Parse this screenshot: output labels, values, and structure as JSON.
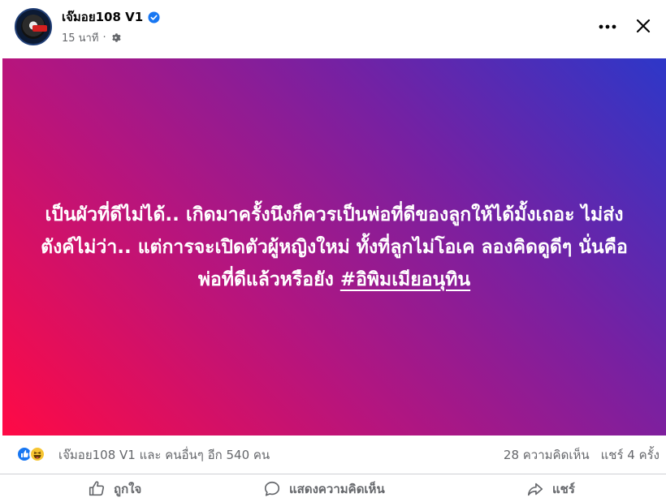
{
  "post": {
    "author": "เจ๊มอย108 V1",
    "verified_icon": "verified-badge-icon",
    "time": "15 นาที",
    "separator": "·",
    "privacy_icon": "gear-icon",
    "more_icon": "more-horizontal-icon",
    "close_icon": "close-icon"
  },
  "banner": {
    "text": "เป็นผัวที่ดีไม่ได้.. เกิดมาครั้งนึงก็ควรเป็นพ่อที่ดีของลูกให้ได้มั้งเถอะ ไม่ส่งตังค์ไม่ว่า.. แต่การจะเปิดตัวผู้หญิงใหม่ ทั้งที่ลูกไม่โอเค ลองคิดดูดีๆ นั่นคือพ่อที่ดีแล้วหรือยัง ",
    "hashtag": "#อิพิมเมียอนุทิน",
    "gradient_colors": [
      "#ff0a45",
      "#b4157f",
      "#7521a3",
      "#2d37c8"
    ],
    "text_color": "#ffffff"
  },
  "stats": {
    "reaction_icons": [
      "like-reaction-icon",
      "haha-reaction-icon"
    ],
    "reactors": "เจ๊มอย108 V1 และ คนอื่นๆ อีก 540 คน",
    "comments": "28 ความคิดเห็น",
    "shares": "แชร์ 4 ครั้ง"
  },
  "actions": {
    "like": "ถูกใจ",
    "comment": "แสดงความคิดเห็น",
    "share": "แชร์"
  },
  "colors": {
    "accent": "#1877f2",
    "secondary_text": "#65676b"
  }
}
